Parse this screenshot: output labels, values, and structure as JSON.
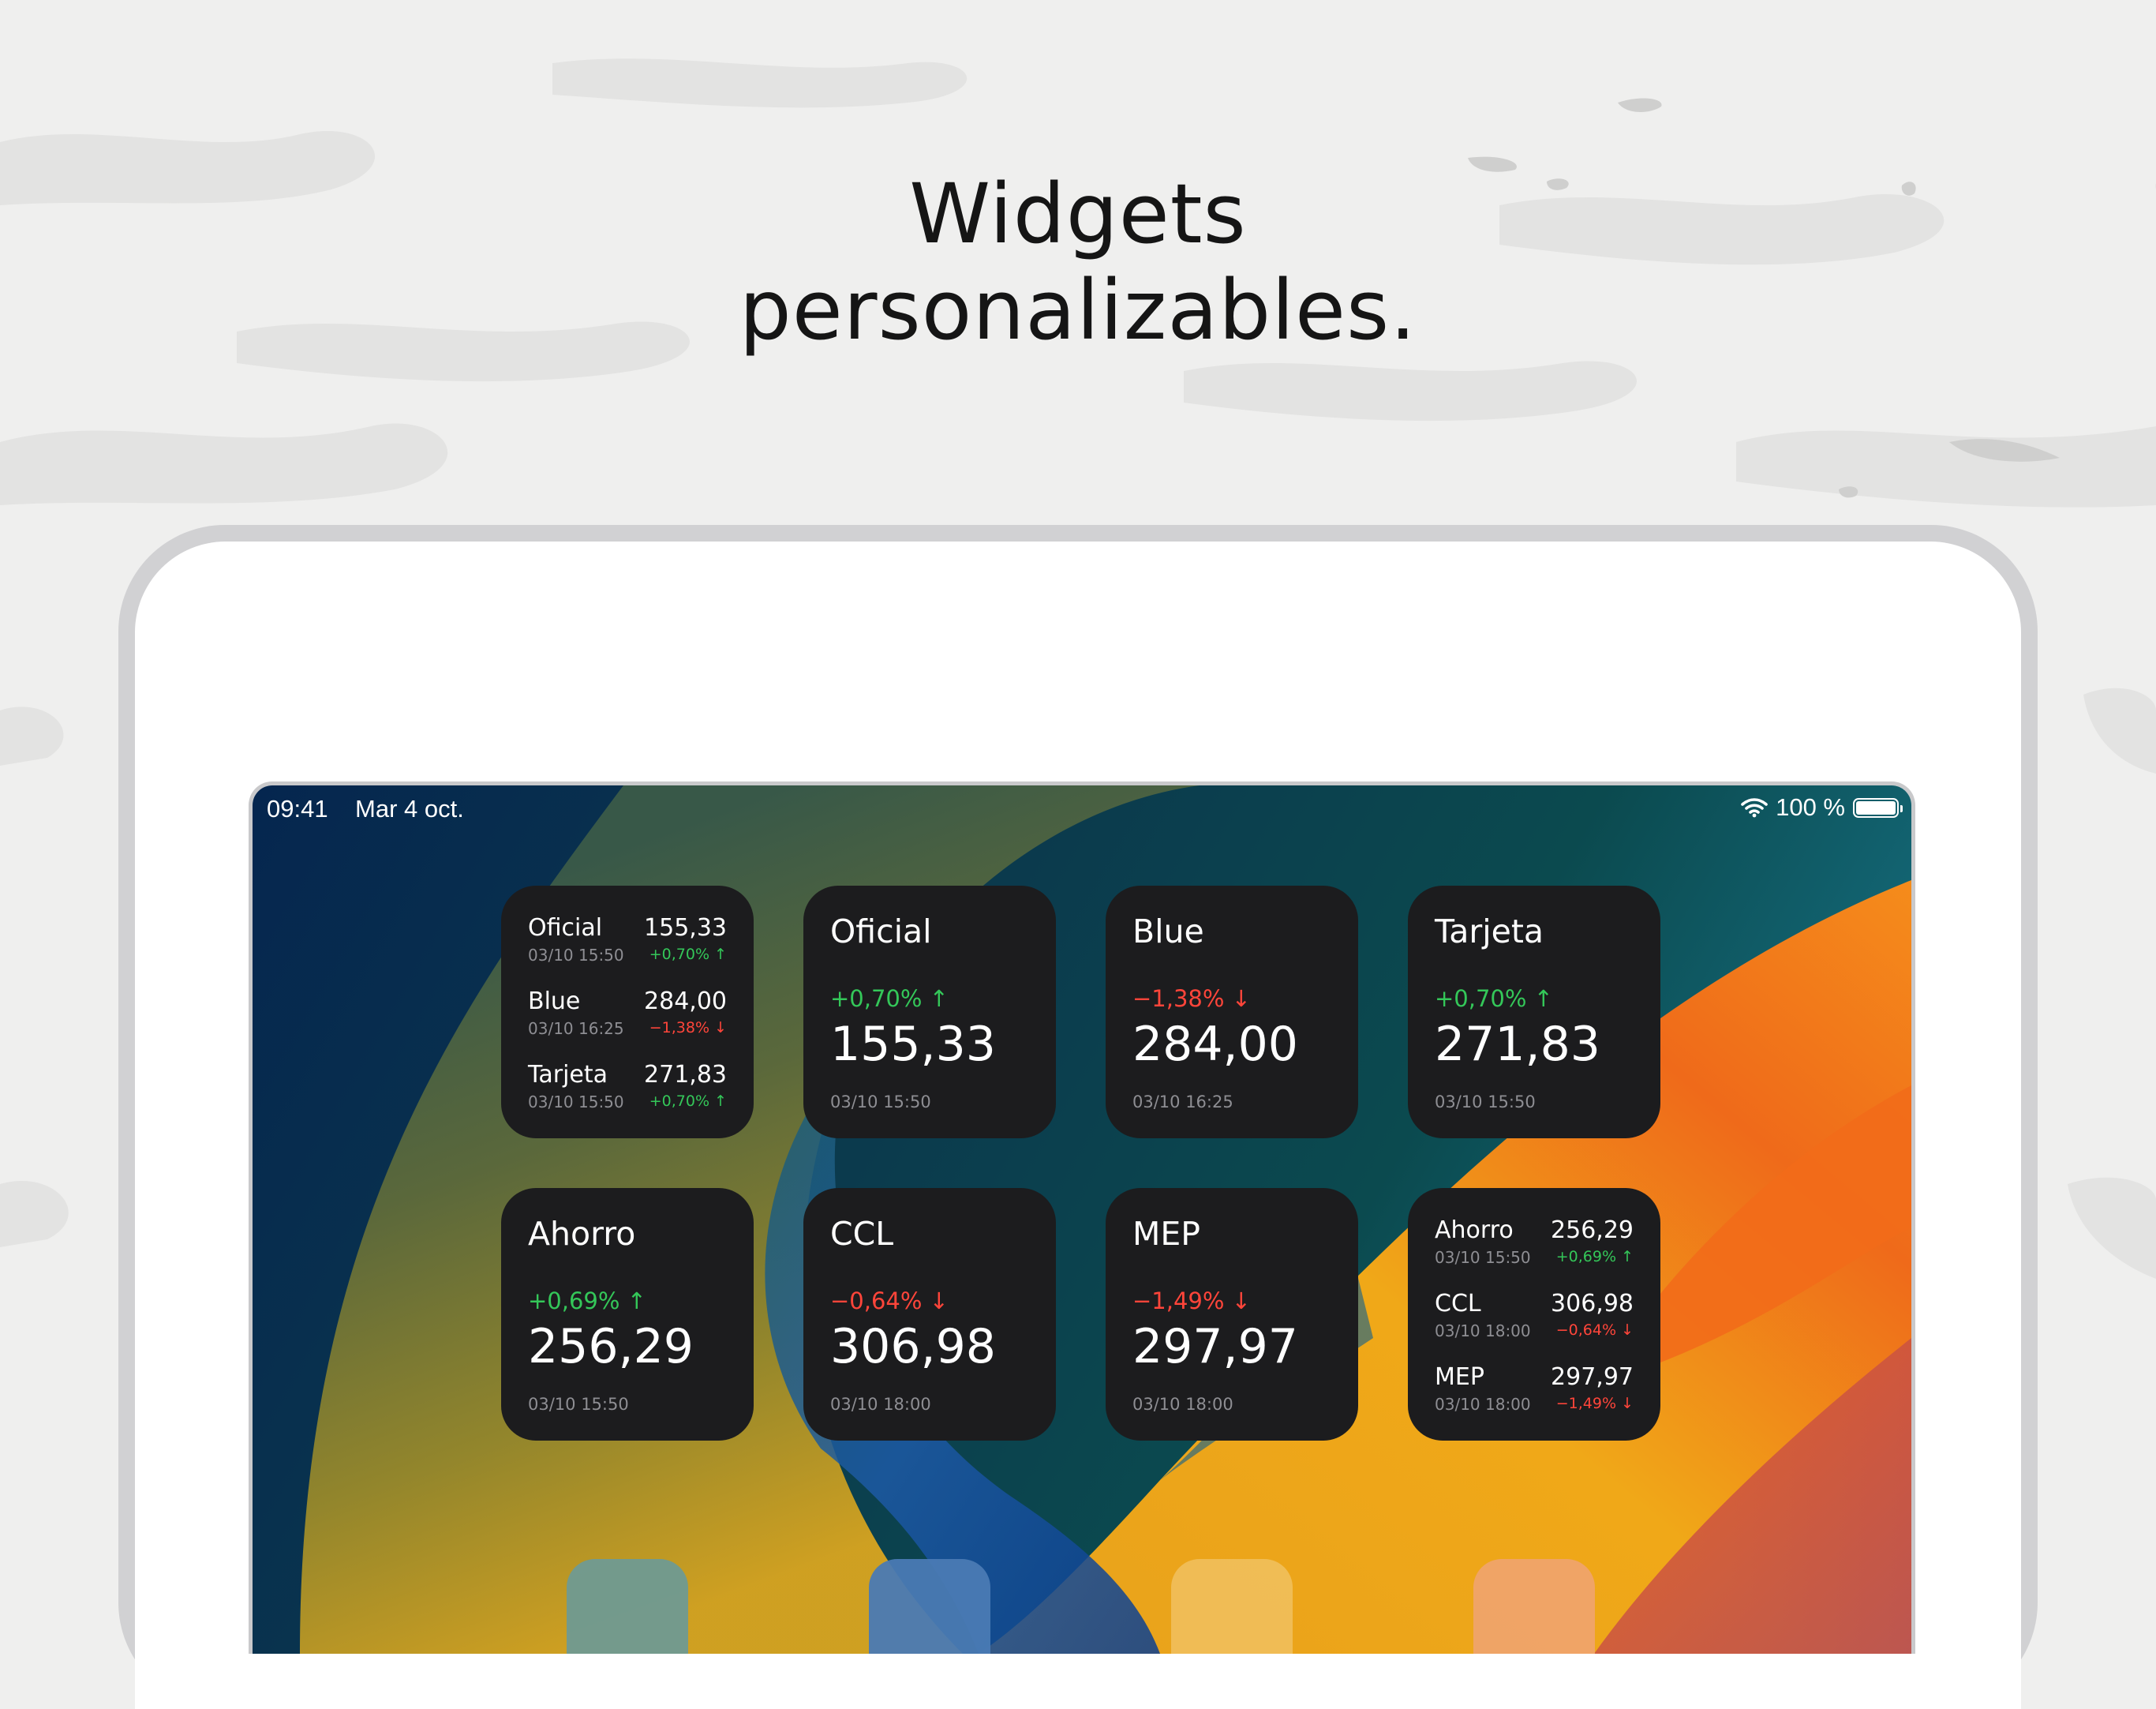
{
  "headline": {
    "line1": "Widgets",
    "line2": "personalizables."
  },
  "status_bar": {
    "time": "09:41",
    "date": "Mar 4 oct.",
    "battery_text": "100 %"
  },
  "widgets_row1": {
    "list": {
      "rows": [
        {
          "name": "Oficial",
          "value": "155,33",
          "time": "03/10 15:50",
          "change": "+0,70% ↑",
          "direction": "up"
        },
        {
          "name": "Blue",
          "value": "284,00",
          "time": "03/10 16:25",
          "change": "−1,38% ↓",
          "direction": "down"
        },
        {
          "name": "Tarjeta",
          "value": "271,83",
          "time": "03/10 15:50",
          "change": "+0,70% ↑",
          "direction": "up"
        }
      ]
    },
    "singles": [
      {
        "name": "Oficial",
        "change": "+0,70% ↑",
        "value": "155,33",
        "time": "03/10 15:50",
        "direction": "up"
      },
      {
        "name": "Blue",
        "change": "−1,38% ↓",
        "value": "284,00",
        "time": "03/10 16:25",
        "direction": "down"
      },
      {
        "name": "Tarjeta",
        "change": "+0,70% ↑",
        "value": "271,83",
        "time": "03/10 15:50",
        "direction": "up"
      }
    ]
  },
  "widgets_row2": {
    "singles": [
      {
        "name": "Ahorro",
        "change": "+0,69% ↑",
        "value": "256,29",
        "time": "03/10 15:50",
        "direction": "up"
      },
      {
        "name": "CCL",
        "change": "−0,64% ↓",
        "value": "306,98",
        "time": "03/10 18:00",
        "direction": "down"
      },
      {
        "name": "MEP",
        "change": "−1,49% ↓",
        "value": "297,97",
        "time": "03/10 18:00",
        "direction": "down"
      }
    ],
    "list": {
      "rows": [
        {
          "name": "Ahorro",
          "value": "256,29",
          "time": "03/10 15:50",
          "change": "+0,69% ↑",
          "direction": "up"
        },
        {
          "name": "CCL",
          "value": "306,98",
          "time": "03/10 18:00",
          "change": "−0,64% ↓",
          "direction": "down"
        },
        {
          "name": "MEP",
          "value": "297,97",
          "time": "03/10 18:00",
          "change": "−1,49% ↓",
          "direction": "down"
        }
      ]
    }
  },
  "colors": {
    "up": "#34c759",
    "down": "#ff453a",
    "widget_bg": "#1c1c1e"
  },
  "icons": [
    "wifi-icon",
    "battery-icon"
  ]
}
